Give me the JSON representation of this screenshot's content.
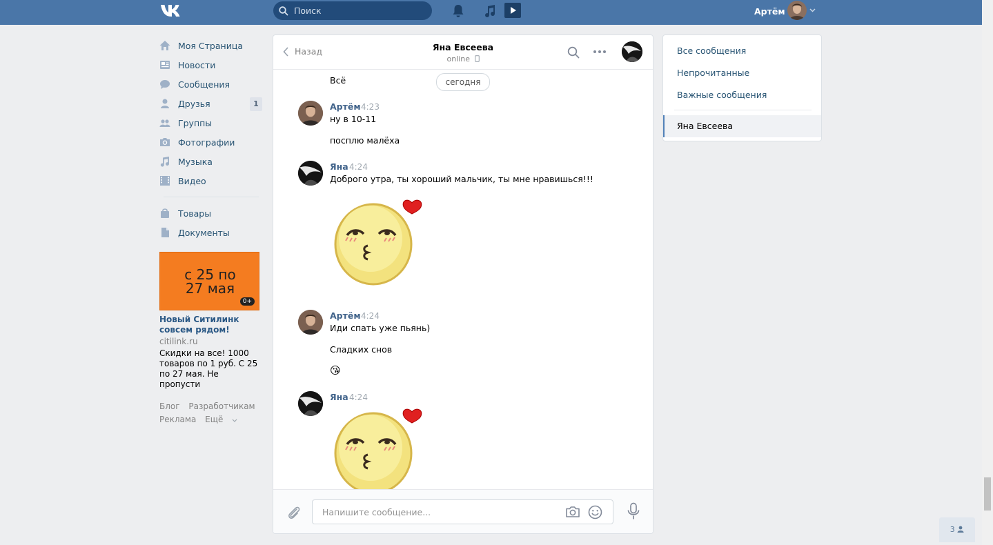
{
  "header": {
    "search_placeholder": "Поиск",
    "user_name": "Артём"
  },
  "nav": {
    "items": [
      {
        "label": "Моя Страница",
        "icon": "home-icon"
      },
      {
        "label": "Новости",
        "icon": "news-icon"
      },
      {
        "label": "Сообщения",
        "icon": "messages-icon"
      },
      {
        "label": "Друзья",
        "icon": "friends-icon",
        "badge": "1"
      },
      {
        "label": "Группы",
        "icon": "groups-icon"
      },
      {
        "label": "Фотографии",
        "icon": "camera-icon"
      },
      {
        "label": "Музыка",
        "icon": "music-icon"
      },
      {
        "label": "Видео",
        "icon": "video-icon"
      }
    ],
    "items2": [
      {
        "label": "Товары",
        "icon": "bag-icon"
      },
      {
        "label": "Документы",
        "icon": "document-icon"
      }
    ]
  },
  "ad": {
    "banner_line1": "с 25 по",
    "banner_line2": "27 мая",
    "age": "0+",
    "title": "Новый Ситилинк совсем рядом!",
    "domain": "citilink.ru",
    "text": "Скидки на все! 1000 товаров по 1 руб. С 25 по 27 мая. Не пропусти"
  },
  "footer": {
    "blog": "Блог",
    "developers": "Разработчикам",
    "ads": "Реклама",
    "more": "Ещё"
  },
  "chat": {
    "back_label": "Назад",
    "peer_name": "Яна Евсеева",
    "peer_status": "online",
    "date_divider": "сегодня",
    "messages": [
      {
        "text": "Всё"
      },
      {
        "author": "Артём",
        "time": "4:23",
        "lines": [
          "ну в 10-11",
          "посплю малёха"
        ]
      },
      {
        "author": "Яна",
        "time": "4:24",
        "lines": [
          "Доброго утра, ты хороший мальчик, ты мне нравишься!!!"
        ]
      },
      {
        "author": "Артём",
        "time": "4:24",
        "lines": [
          "Иди спать уже пьянь)",
          "Сладких снов"
        ],
        "emoji": "😘"
      },
      {
        "author": "Яна",
        "time": "4:24"
      }
    ],
    "compose_placeholder": "Напишите сообщение..."
  },
  "filters": {
    "all": "Все сообщения",
    "unread": "Непрочитанные",
    "important": "Важные сообщения",
    "active_conversation": "Яна Евсеева"
  },
  "friends_online": {
    "count": "3"
  },
  "colors": {
    "header": "#4a76a8",
    "link": "#285473",
    "author": "#42648b",
    "background": "#edeef0"
  }
}
